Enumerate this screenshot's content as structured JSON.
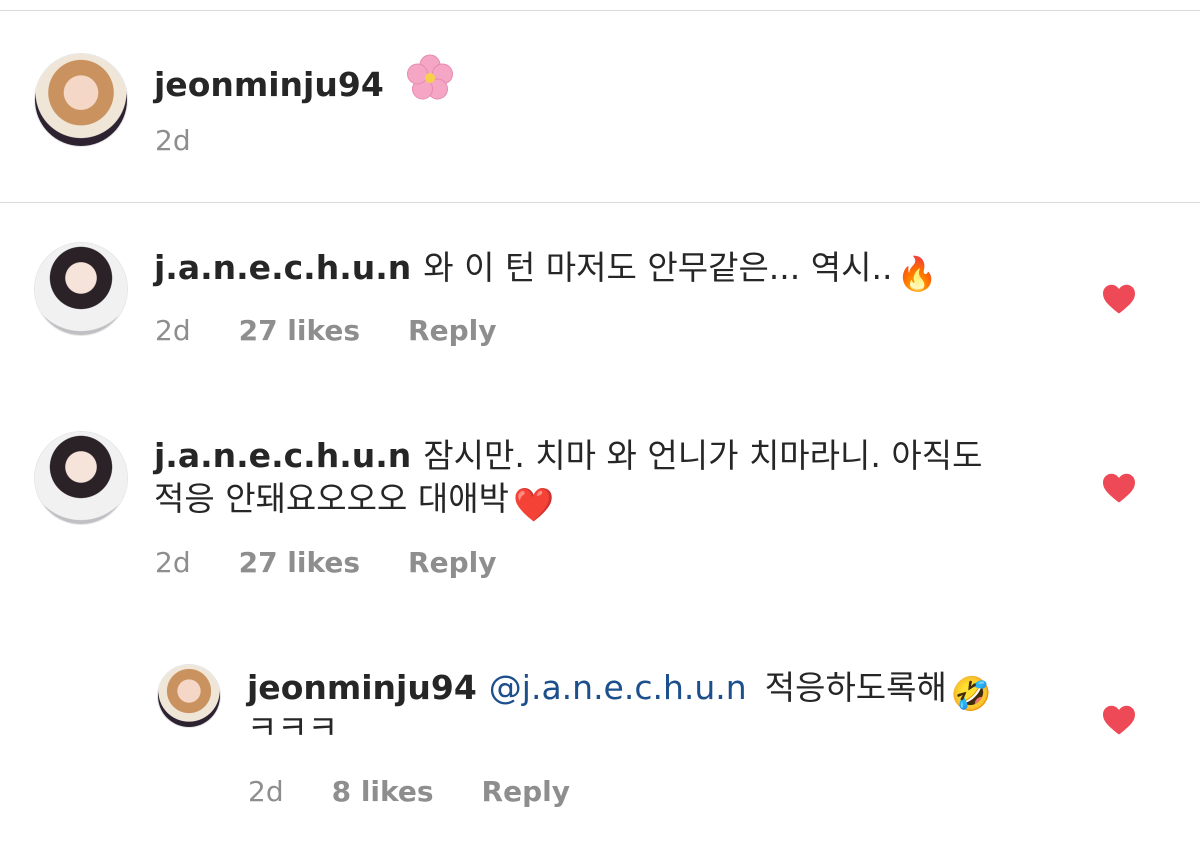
{
  "post": {
    "username": "jeonminju94",
    "flower_emoji": "🌸",
    "time": "2d"
  },
  "comments": [
    {
      "username": "j.a.n.e.c.h.u.n",
      "text": "와 이 턴 마저도 안무같은... 역시..",
      "emoji": "🔥",
      "time": "2d",
      "likes": "27 likes",
      "reply": "Reply",
      "liked": true
    },
    {
      "username": "j.a.n.e.c.h.u.n",
      "text_line1": "잠시만. 치마 와 언니가 치마라니. 아직도",
      "text_line2": "적응 안돼요오오오 대애박",
      "emoji": "❤️",
      "time": "2d",
      "likes": "27 likes",
      "reply": "Reply",
      "liked": true
    }
  ],
  "reply": {
    "username": "jeonminju94",
    "mention": "@j.a.n.e.c.h.u.n",
    "text_line1": "적응하도록해",
    "emoji": "🤣",
    "text_line2": "ㅋㅋㅋ",
    "time": "2d",
    "likes": "8 likes",
    "reply": "Reply",
    "liked": true
  },
  "icons": {
    "avatar_minju": "avatar-photo",
    "avatar_jane": "avatar-photo",
    "like": "heart-icon"
  },
  "colors": {
    "heart": "#ed4956",
    "meta_text": "#8e8e8e",
    "mention": "#1c4f8b",
    "divider": "#dbdbdb"
  }
}
